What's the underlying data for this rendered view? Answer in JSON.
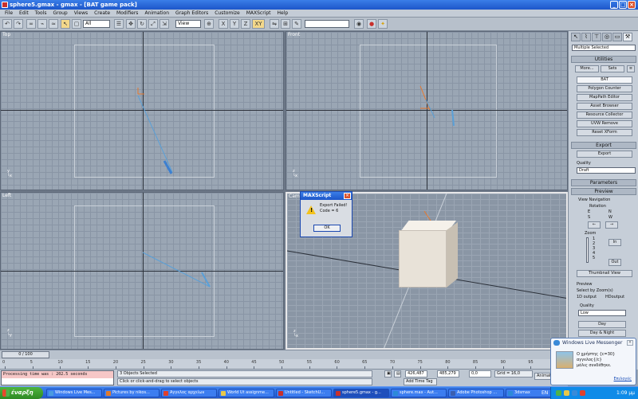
{
  "window": {
    "title": "sphere5.gmax - gmax - [BAT game pack]"
  },
  "menu": [
    "File",
    "Edit",
    "Tools",
    "Group",
    "Views",
    "Create",
    "Modifiers",
    "Animation",
    "Graph Editors",
    "Customize",
    "MAXScript",
    "Help"
  ],
  "toolbar": {
    "selection_filter": "All",
    "ref_coord": "View",
    "axis_xy": "XY"
  },
  "viewports": {
    "top": "Top",
    "front": "Front",
    "left": "Left",
    "perspective": "Camera"
  },
  "dialog": {
    "title": "MAXScript",
    "message": "Export Failed!\nCode = 6",
    "ok": "OK"
  },
  "command_panel": {
    "selection": "Multiple Selected",
    "utilities": {
      "header": "Utilities",
      "more": "More...",
      "sets": "Sets",
      "items": [
        "BAT",
        "Polygon Counter",
        "MapPath Editor",
        "Asset Browser",
        "Resource Collector",
        "UVW Remove",
        "Reset XForm"
      ]
    },
    "export": {
      "header": "Export",
      "button": "Export",
      "quality_label": "Quality",
      "quality_value": "Draft"
    },
    "parameters": {
      "header": "Parameters"
    },
    "preview": {
      "header": "Preview",
      "view_navigation": "View Navigation",
      "rotation": "Rotation",
      "compass": [
        "E",
        "N",
        "S",
        "W"
      ],
      "zoom": "Zoom",
      "zoom_in": "In",
      "zoom_out": "Out",
      "zoom_levels": [
        "1",
        "2",
        "3",
        "4",
        "5"
      ],
      "thumbnail_view": "Thumbnail View"
    },
    "preview_sub": {
      "header": "Preview",
      "select_zoom": "Select by Zoom(s)",
      "opt_1d": "1D output",
      "opt_hd": "HDoutput",
      "quality_label": "Quality",
      "quality_value": "Low",
      "day": "Day",
      "day_night": "Day & Night"
    }
  },
  "timeline": {
    "frame": "0 / 100",
    "ticks": [
      "0",
      "5",
      "10",
      "15",
      "20",
      "25",
      "30",
      "35",
      "40",
      "45",
      "50",
      "55",
      "60",
      "65",
      "70",
      "75",
      "80",
      "85",
      "90",
      "95",
      "100"
    ]
  },
  "status": {
    "listener": "Processing time was : 202.5 seconds",
    "selected": "3 Objects Selected",
    "prompt": "Click or click-and-drag to select objects",
    "x": "426,487",
    "y": "485,279",
    "z": "0,0",
    "grid": "Grid = 16,0",
    "add_time_tag": "Add Time Tag",
    "animate": "Animate"
  },
  "toast": {
    "title": "Windows Live Messenger",
    "message": "Ο χρήστης {c=30}\nαγγελος{/c}\nμόλις συνδέθηκε.",
    "options": "Επιλογές"
  },
  "taskbar": {
    "start": "έναρξη",
    "tasks": [
      {
        "label": "Windows Live Mes...",
        "color": "#4a9ae0"
      },
      {
        "label": "Pictures by nikos...",
        "color": "#e07a2c"
      },
      {
        "label": "Αγγελος αρχείων",
        "color": "#e0402c"
      },
      {
        "label": "World Ut assignme...",
        "color": "#e8c84a"
      },
      {
        "label": "Untitled - SketchU...",
        "color": "#c8302c"
      },
      {
        "label": "sphere5.gmax - g...",
        "color": "#c8302c"
      },
      {
        "label": "sphere.max - Aut...",
        "color": "#2c8ad8"
      },
      {
        "label": "Adobe Photoshop ...",
        "color": "#3a5fb0"
      },
      {
        "label": "3dsmax",
        "color": "#2c8ad8"
      }
    ],
    "language": "EN",
    "clock": "1:09 μμ"
  }
}
